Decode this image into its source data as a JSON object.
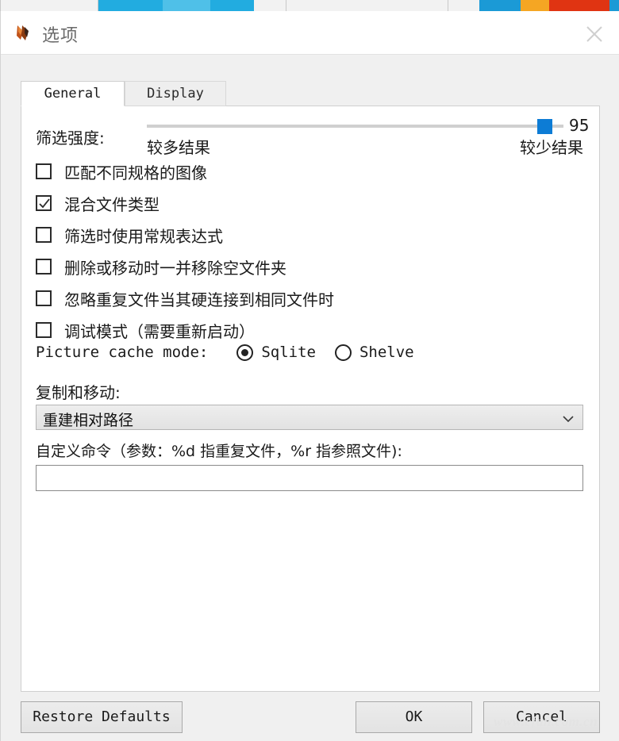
{
  "window": {
    "title": "选项",
    "icon": "app-arrows-icon",
    "close_icon": "close-icon"
  },
  "tabs": [
    {
      "label": "General",
      "active": true
    },
    {
      "label": "Display",
      "active": false
    }
  ],
  "general": {
    "slider": {
      "label": "筛选强度:",
      "min_label": "较多结果",
      "max_label": "较少结果",
      "value": "95",
      "percent": 95,
      "handle_color": "#0d7cd5"
    },
    "checkboxes": [
      {
        "label": "匹配不同规格的图像",
        "checked": false
      },
      {
        "label": "混合文件类型",
        "checked": true
      },
      {
        "label": "筛选时使用常规表达式",
        "checked": false
      },
      {
        "label": "删除或移动时一并移除空文件夹",
        "checked": false
      },
      {
        "label": "忽略重复文件当其硬连接到相同文件时",
        "checked": false
      },
      {
        "label": "调试模式（需要重新启动）",
        "checked": false
      }
    ],
    "picture_cache": {
      "caption": "Picture cache mode:",
      "options": [
        {
          "label": "Sqlite",
          "selected": true
        },
        {
          "label": "Shelve",
          "selected": false
        }
      ]
    },
    "copy_move": {
      "label": "复制和移动:",
      "selected": "重建相对路径",
      "arrow_icon": "chevron-down-icon"
    },
    "custom_command": {
      "label": "自定义命令（参数：%d 指重复文件，%r 指参照文件):",
      "value": "",
      "placeholder": ""
    }
  },
  "footer": {
    "restore_label": "Restore Defaults",
    "ok_label": "OK",
    "cancel_label": "Cancel"
  },
  "watermark": "www.cfan.com.cn"
}
